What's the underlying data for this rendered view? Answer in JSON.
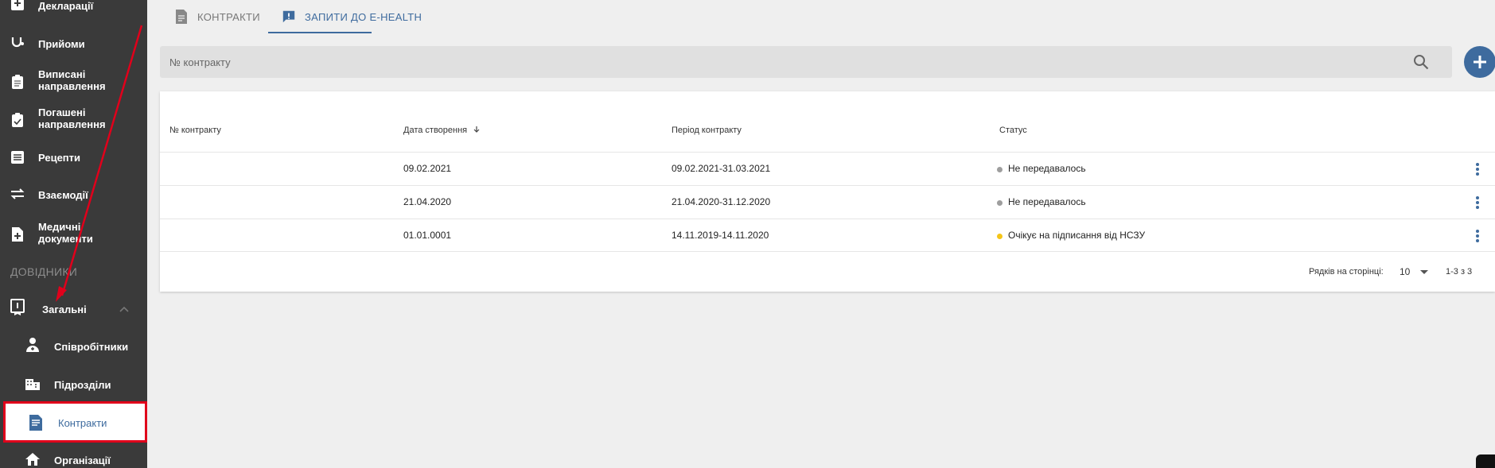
{
  "sidebar": {
    "items": [
      {
        "label": "Декларації",
        "icon": "plus-doc-icon"
      },
      {
        "label": "Прийоми",
        "icon": "stethoscope-icon"
      },
      {
        "label": "Виписані направлення",
        "icon": "clipboard-icon"
      },
      {
        "label": "Погашені направлення",
        "icon": "clipboard-check-icon"
      },
      {
        "label": "Рецепти",
        "icon": "list-icon"
      },
      {
        "label": "Взаємодії",
        "icon": "swap-icon"
      },
      {
        "label": "Медичні документи",
        "icon": "medical-doc-icon"
      }
    ],
    "section_title": "ДОВІДНИКИ",
    "group": {
      "label": "Загальні",
      "icon": "book-icon"
    },
    "subitems": [
      {
        "label": "Співробітники",
        "icon": "doctor-icon"
      },
      {
        "label": "Підрозділи",
        "icon": "building-icon"
      },
      {
        "label": "Контракти",
        "icon": "contract-icon",
        "active": true
      },
      {
        "label": "Організації",
        "icon": "home-icon"
      }
    ]
  },
  "tabs": [
    {
      "label": "КОНТРАКТИ",
      "icon": "contract-doc-icon"
    },
    {
      "label": "ЗАПИТИ ДО E-HEALTH",
      "icon": "feedback-icon",
      "active": true
    }
  ],
  "search": {
    "placeholder": "№ контракту"
  },
  "table": {
    "columns": [
      "№ контракту",
      "Дата створення",
      "Період контракту",
      "Статус"
    ],
    "rows": [
      {
        "number": "",
        "created": "09.02.2021",
        "period": "09.02.2021-31.03.2021",
        "status": "Не передавалось",
        "status_color": "#9e9e9e"
      },
      {
        "number": "",
        "created": "21.04.2020",
        "period": "21.04.2020-31.12.2020",
        "status": "Не передавалось",
        "status_color": "#9e9e9e"
      },
      {
        "number": "",
        "created": "01.01.0001",
        "period": "14.11.2019-14.11.2020",
        "status": "Очікує на підписання від НСЗУ",
        "status_color": "#f5c518"
      }
    ],
    "footer": {
      "rows_per_page_label": "Рядків на сторінці:",
      "rows_per_page": "10",
      "range": "1-3 з 3"
    }
  },
  "colors": {
    "sidebar_bg": "#3a3a3a",
    "accent": "#3e6b9e",
    "highlight": "#e0001b"
  }
}
